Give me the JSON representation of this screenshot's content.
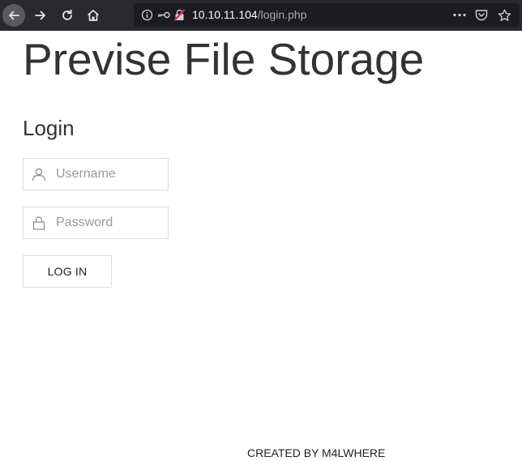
{
  "browser": {
    "url_host": "10.10.11.104",
    "url_path": "/login.php",
    "nav": {
      "back_icon": "arrow-left-icon",
      "forward_icon": "arrow-right-icon",
      "reload_icon": "reload-icon",
      "home_icon": "home-icon"
    },
    "url_icons": [
      "info-icon",
      "key-icon",
      "insecure-lock-icon"
    ],
    "actions": [
      "more-options-icon",
      "pocket-icon",
      "bookmark-star-icon"
    ],
    "colors": {
      "toolbar": "#2a2a2e",
      "urlbar": "#1c1b22",
      "insecure_accent": "#e22850"
    }
  },
  "page": {
    "title": "Previse File Storage",
    "login_heading": "Login",
    "username_placeholder": "Username",
    "password_placeholder": "Password",
    "login_button": "LOG IN",
    "footer": "CREATED BY M4LWHERE"
  }
}
